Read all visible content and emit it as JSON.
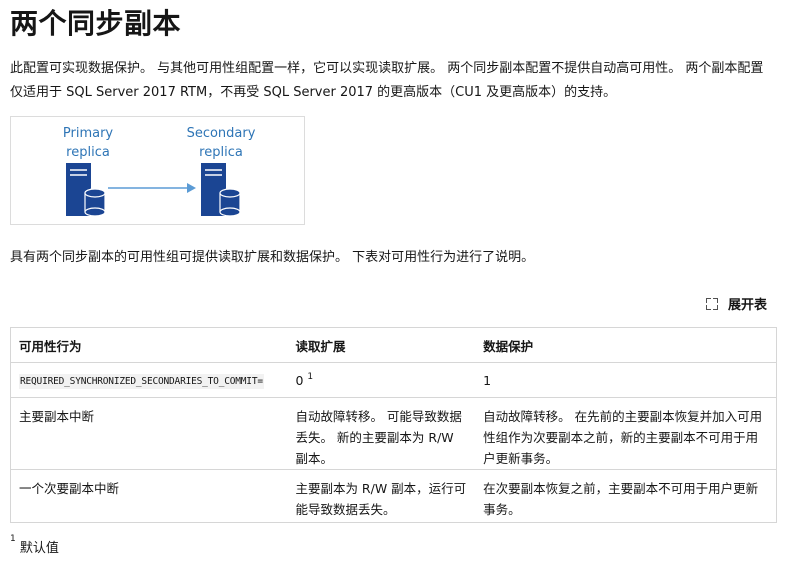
{
  "heading": "两个同步副本",
  "intro": "此配置可实现数据保护。 与其他可用性组配置一样，它可以实现读取扩展。 两个同步副本配置不提供自动高可用性。 两个副本配置仅适用于 SQL Server 2017 RTM，不再受 SQL Server 2017 的更高版本（CU1 及更高版本）的支持。",
  "diagram": {
    "primary_line1": "Primary",
    "primary_line2": "replica",
    "secondary_line1": "Secondary",
    "secondary_line2": "replica",
    "server_color": "#1b4593",
    "label_color": "#2e75b6",
    "arrow_color": "#5b9bd5"
  },
  "summary": "具有两个同步副本的可用性组可提供读取扩展和数据保护。 下表对可用性行为进行了说明。",
  "expand_label": "展开表",
  "table": {
    "headers": [
      "可用性行为",
      "读取扩展",
      "数据保护"
    ],
    "row1": {
      "behavior": "REQUIRED_SYNCHRONIZED_SECONDARIES_TO_COMMIT=",
      "read": "0",
      "read_sup": "1",
      "protect": "1"
    },
    "row2": {
      "behavior": "主要副本中断",
      "read": "自动故障转移。 可能导致数据丢失。 新的主要副本为 R/W 副本。",
      "protect": "自动故障转移。 在先前的主要副本恢复并加入可用性组作为次要副本之前，新的主要副本不可用于用户更新事务。"
    },
    "row3": {
      "behavior": "一个次要副本中断",
      "read": "主要副本为 R/W 副本，运行可能导致数据丢失。",
      "protect": "在次要副本恢复之前，主要副本不可用于用户更新事务。"
    }
  },
  "footnote": {
    "marker": "1",
    "text": "默认值"
  }
}
